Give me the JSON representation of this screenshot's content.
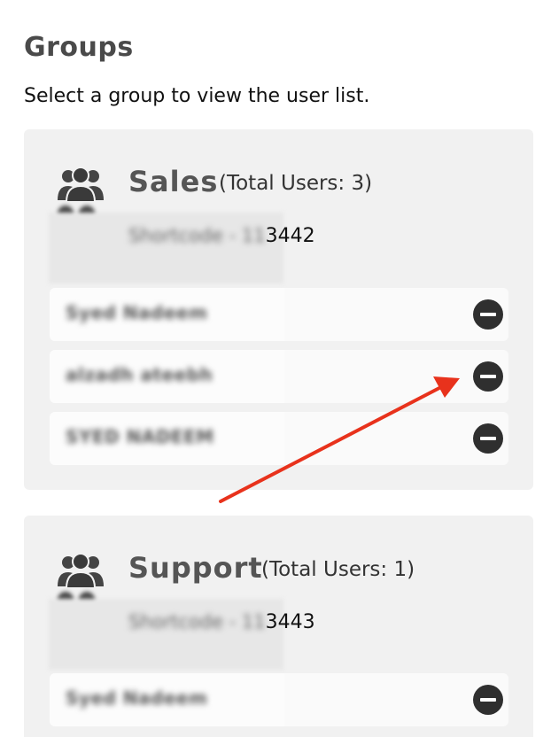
{
  "page": {
    "title": "Groups",
    "subtitle": "Select a group to view the user list."
  },
  "groups": [
    {
      "name": "Sales",
      "count_label": "(Total Users: 3)",
      "shortcode_prefix": "Shortcode - 11",
      "shortcode_visible": "3442",
      "members": [
        {
          "name": "Syed Nadeem"
        },
        {
          "name": "alzadh ateebh"
        },
        {
          "name": "SYED NADEEM"
        }
      ]
    },
    {
      "name": "Support",
      "count_label": "(Total Users: 1)",
      "shortcode_prefix": "Shortcode - 11",
      "shortcode_visible": "3443",
      "members": [
        {
          "name": "Syed Nadeem"
        }
      ]
    }
  ],
  "icons": {
    "group": "users-group-icon",
    "settings": "gear-icon",
    "remove": "minus-circle-icon"
  },
  "colors": {
    "card_background": "#f1f1f1",
    "row_background": "#fafafa",
    "remove_button": "#2f2f2f",
    "annotation_arrow": "#e8321c"
  }
}
